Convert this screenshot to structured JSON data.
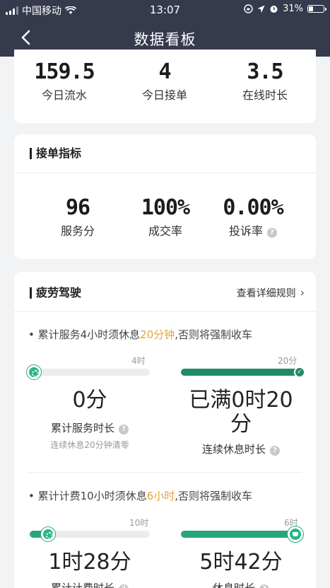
{
  "status_bar": {
    "carrier": "中国移动",
    "time": "13:07",
    "battery_percent": "31%",
    "battery_level": 0.31,
    "icons": [
      "signal-icon",
      "wifi-icon",
      "screen-lock-icon",
      "location-icon",
      "alarm-icon",
      "battery-icon"
    ]
  },
  "nav": {
    "back_icon": "chevron-left-icon",
    "title": "数据看板"
  },
  "summary": [
    {
      "value": "159.5",
      "label": "今日流水"
    },
    {
      "value": "4",
      "label": "今日接单"
    },
    {
      "value": "3.5",
      "label": "在线时长"
    }
  ],
  "order_metrics": {
    "title": "接单指标",
    "items": [
      {
        "value": "96",
        "label": "服务分"
      },
      {
        "value": "100%",
        "label": "成交率"
      },
      {
        "value": "0.00%",
        "label": "投诉率",
        "help_icon": "question-icon"
      }
    ]
  },
  "fatigue": {
    "title": "疲劳驾驶",
    "rules_link": "查看详细规则",
    "rule1": {
      "prefix": "• 累计服务4小时须休息",
      "highlight": "20分钟",
      "suffix": ",否则将强制收车"
    },
    "service_bar": {
      "max_label": "4时",
      "progress": 0.0,
      "value": "0分",
      "label": "累计服务时长",
      "note": "连续休息20分钟清零"
    },
    "rest_bar": {
      "max_label": "20分",
      "progress": 1.0,
      "value_line1": "已满0时20",
      "value_line2": "分",
      "label": "连续休息时长"
    },
    "rule2": {
      "prefix": "• 累计计费10小时须休息",
      "highlight": "6小时",
      "suffix": ",否则将强制收车"
    },
    "billing_bar": {
      "max_label": "10时",
      "progress": 0.15,
      "value": "1时28分",
      "label": "累计计费时长"
    },
    "rest2_bar": {
      "max_label": "6时",
      "progress": 0.95,
      "value": "5时42分",
      "label": "休息时长"
    }
  },
  "colors": {
    "header": "#363a4d",
    "accent_green": "#27a67d",
    "highlight_orange": "#e8a33a"
  }
}
